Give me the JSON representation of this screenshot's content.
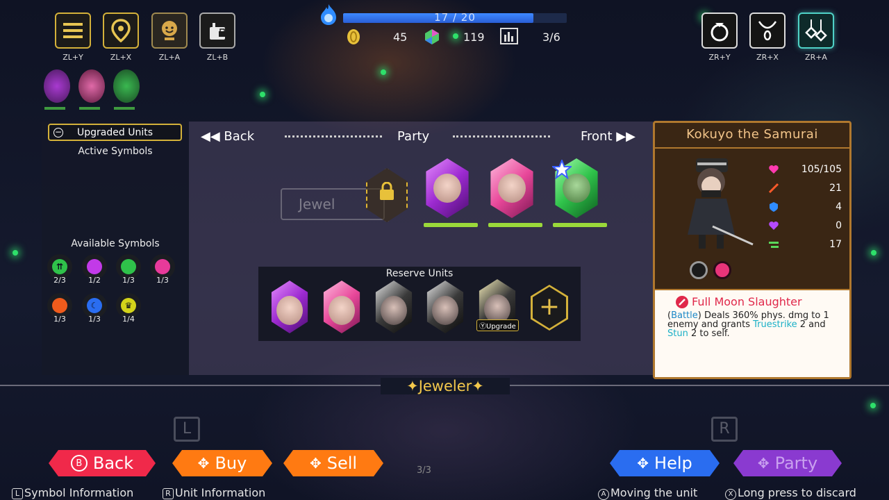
{
  "top_buttons": [
    {
      "name": "menu",
      "combo": "ZL+Y"
    },
    {
      "name": "map",
      "combo": "ZL+X"
    },
    {
      "name": "character",
      "combo": "ZL+A"
    },
    {
      "name": "inventory",
      "combo": "ZL+B"
    }
  ],
  "accessory_buttons": [
    {
      "name": "ring",
      "combo": "ZR+Y"
    },
    {
      "name": "necklace",
      "combo": "ZR+X"
    },
    {
      "name": "earrings",
      "combo": "ZR+A"
    }
  ],
  "stats": {
    "hp_text": "17 / 20",
    "hp_fraction": 0.85,
    "gold": "45",
    "gems": "119",
    "party_count": "3/6"
  },
  "left_panel": {
    "upgraded_units_label": "Upgraded Units",
    "active_symbols_label": "Active Symbols",
    "available_symbols_label": "Available Symbols",
    "symbols": [
      {
        "color": "#2fc24a",
        "count": "2/3"
      },
      {
        "color": "#c23ae8",
        "count": "1/2"
      },
      {
        "color": "#2fc24a",
        "count": "1/3"
      },
      {
        "color": "#e83a9a",
        "count": "1/3"
      },
      {
        "color": "#ef5b1c",
        "count": "1/3"
      },
      {
        "color": "#2a6df0",
        "count": "1/3"
      },
      {
        "color": "#d4d41a",
        "count": "1/4"
      }
    ]
  },
  "party": {
    "back_label": "Back",
    "title": "Party",
    "front_label": "Front",
    "ghost_button_label": "Jewel",
    "reserve_title": "Reserve Units",
    "upgrade_tag": "Upgrade"
  },
  "unit_info": {
    "name": "Kokuyo the Samurai",
    "hp": "105/105",
    "attack": "21",
    "defense": "4",
    "magic": "0",
    "speed": "17",
    "skill_name": "Full Moon Slaughter",
    "skill_prefix": "(",
    "skill_kw1": "Battle",
    "skill_mid": ") Deals 360% phys. dmg to 1 enemy and grants ",
    "skill_kw2": "Truestrike",
    "skill_mid2": " 2 and ",
    "skill_kw3": "Stun",
    "skill_suffix": " 2 to self."
  },
  "bottom": {
    "shop_title": "Jeweler",
    "page": "3/3",
    "back": "Back",
    "buy": "Buy",
    "sell": "Sell",
    "help": "Help",
    "party": "Party",
    "hint_symbol": "Symbol Information",
    "hint_unit": "Unit Information",
    "hint_move": "Moving the unit",
    "hint_discard": "Long press to discard",
    "key_l": "L",
    "key_r": "R",
    "key_a": "A",
    "key_x": "X",
    "key_b": "B"
  },
  "colors": {
    "gold_border": "#d4b13a",
    "back_btn": "#f0294a",
    "buy_btn": "#ff7a12",
    "sell_btn": "#ff7a12",
    "help_btn": "#2a6df0",
    "party_btn": "#8a3ad0",
    "info_panel": "#3a2614"
  }
}
